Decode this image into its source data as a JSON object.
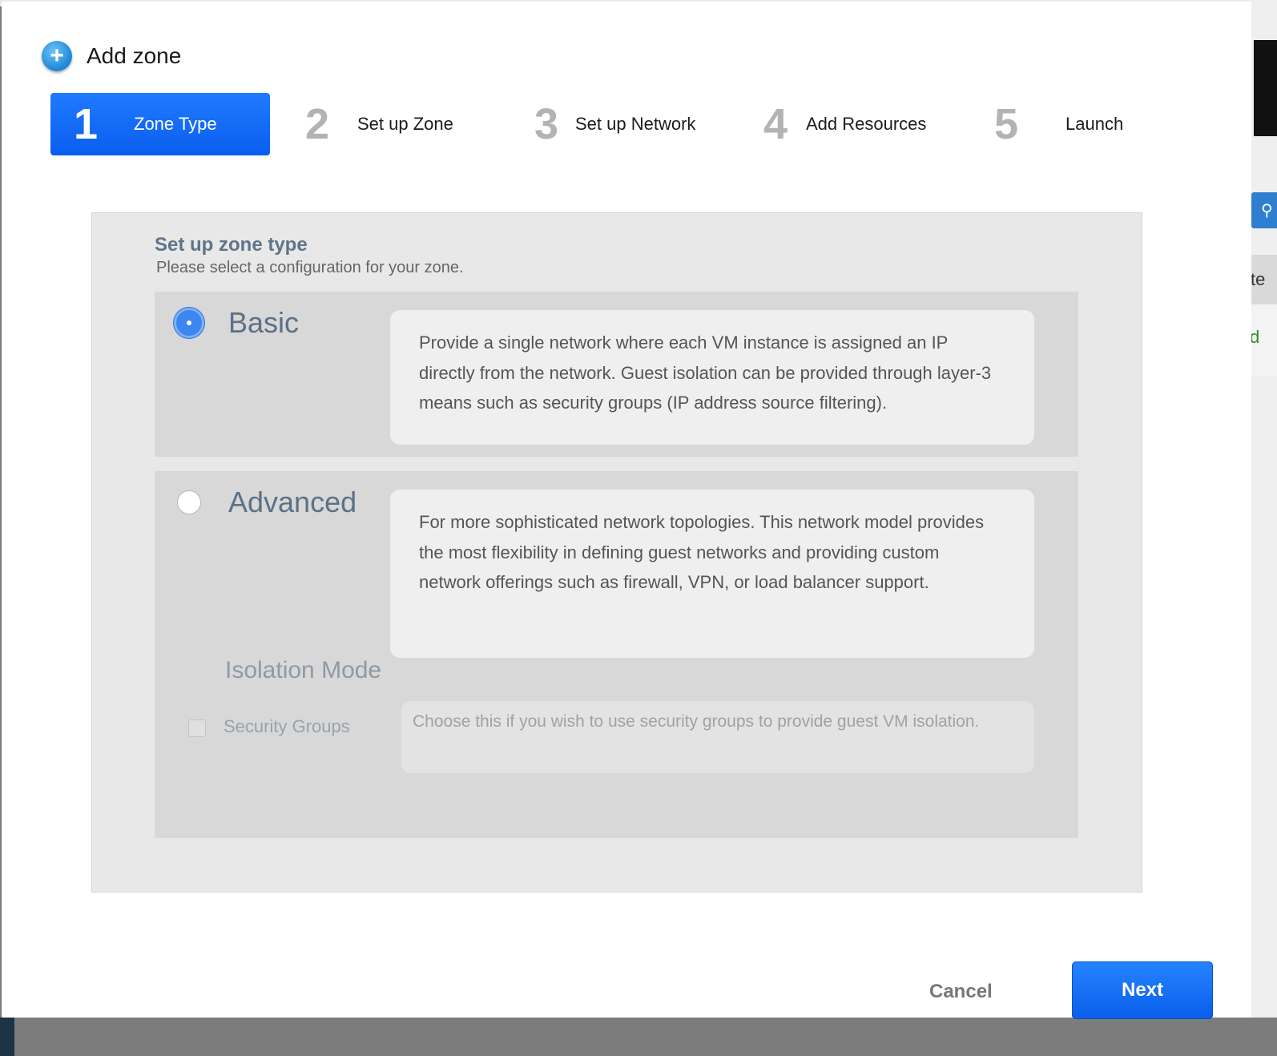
{
  "dialog": {
    "title": "Add zone",
    "add_icon": "plus-circle-icon"
  },
  "steps": [
    {
      "number": "1",
      "label": "Zone Type",
      "active": true
    },
    {
      "number": "2",
      "label": "Set up Zone",
      "active": false
    },
    {
      "number": "3",
      "label": "Set up Network",
      "active": false
    },
    {
      "number": "4",
      "label": "Add Resources",
      "active": false
    },
    {
      "number": "5",
      "label": "Launch",
      "active": false
    }
  ],
  "panel": {
    "title": "Set up zone type",
    "subtitle": "Please select a configuration for your zone.",
    "options": {
      "basic": {
        "name": "Basic",
        "selected": true,
        "description": "Provide a single network where each VM instance is assigned an IP directly from the network. Guest isolation can be provided through layer-3 means such as security groups (IP address source filtering)."
      },
      "advanced": {
        "name": "Advanced",
        "selected": false,
        "description": "For more sophisticated network topologies. This network model provides the most flexibility in defining guest networks and providing custom network offerings such as firewall, VPN, or load balancer support.",
        "isolation_mode_label": "Isolation Mode",
        "security_groups": {
          "label": "Security Groups",
          "checked": false,
          "description": "Choose this if you wish to use security groups to provide guest VM isolation."
        }
      }
    }
  },
  "footer": {
    "cancel_label": "Cancel",
    "next_label": "Next"
  },
  "background": {
    "right_fragment_1": "te",
    "right_fragment_2": "d",
    "search_icon": "search-icon"
  },
  "colors": {
    "accent": "#0a5eee",
    "panel_title": "#5f7489",
    "radio_selected": "#3d86f0"
  }
}
